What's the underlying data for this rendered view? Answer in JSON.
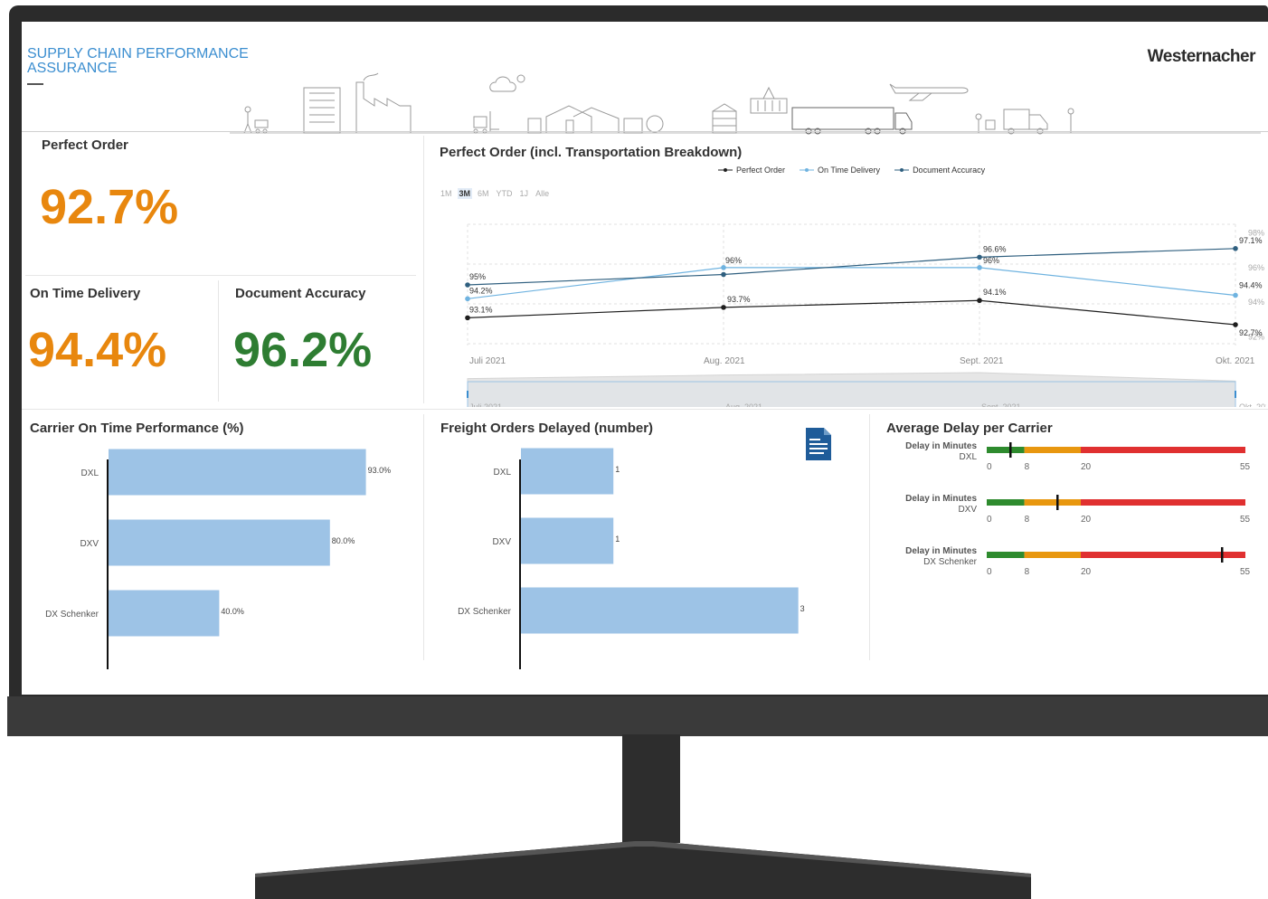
{
  "header": {
    "title_line1": "SUPPLY CHAIN PERFORMANCE",
    "title_line2": "ASSURANCE",
    "brand": "Westernacher"
  },
  "colors": {
    "orange": "#e8870e",
    "green": "#2e7d32",
    "bar_blue": "#9dc3e6",
    "accent_blue": "#3b8ed0",
    "dark_line": "#1e1e1e",
    "bullet_green": "#2e8b2e",
    "bullet_orange": "#e8970f",
    "bullet_red": "#e03030"
  },
  "kpis": {
    "perfect_order": {
      "label": "Perfect Order",
      "value": "92.7%"
    },
    "on_time": {
      "label": "On Time Delivery",
      "value": "94.4%"
    },
    "doc_accuracy": {
      "label": "Document Accuracy",
      "value": "96.2%"
    }
  },
  "line_panel": {
    "title": "Perfect Order (incl. Transportation Breakdown)",
    "legend": [
      "Perfect Order",
      "On Time Delivery",
      "Document Accuracy"
    ],
    "range_buttons": [
      "1M",
      "3M",
      "6M",
      "YTD",
      "1J",
      "Alle"
    ],
    "active_range": "3M",
    "right_ticks": [
      "98%",
      "96%",
      "94%",
      "92%"
    ],
    "navigator_labels": [
      "Juli 2021",
      "Aug. 2021",
      "Sept. 2021",
      "Okt. 2021"
    ]
  },
  "chart_data": [
    {
      "type": "line",
      "title": "Perfect Order (incl. Transportation Breakdown)",
      "categories": [
        "Juli 2021",
        "Aug. 2021",
        "Sept. 2021",
        "Okt. 2021"
      ],
      "ylim": [
        91.5,
        98.5
      ],
      "legend_position": "top-right",
      "series": [
        {
          "name": "Perfect Order",
          "values": [
            93.1,
            93.7,
            94.1,
            92.7
          ],
          "labels": [
            "93.1%",
            "93.7%",
            "94.1%",
            "92.7%"
          ],
          "color": "#1e1e1e"
        },
        {
          "name": "On Time Delivery",
          "values": [
            94.2,
            96,
            96,
            94.4
          ],
          "labels": [
            "94.2%",
            "96%",
            "96%",
            "94.4%"
          ],
          "color": "#6fb3e0"
        },
        {
          "name": "Document Accuracy",
          "values": [
            95,
            95.6,
            96.6,
            97.1
          ],
          "labels": [
            "95%",
            "",
            "96.6%",
            "97.1%"
          ],
          "color": "#2f5f7f"
        }
      ]
    },
    {
      "type": "bar",
      "title": "Carrier On Time Performance (%)",
      "categories": [
        "DXL",
        "DXV",
        "DX Schenker"
      ],
      "values": [
        93.0,
        80.0,
        40.0
      ],
      "labels": [
        "93.0%",
        "80.0%",
        "40.0%"
      ],
      "xlim": [
        0,
        100
      ]
    },
    {
      "type": "bar",
      "title": "Freight Orders Delayed (number)",
      "categories": [
        "DXL",
        "DXV",
        "DX Schenker"
      ],
      "values": [
        1,
        1,
        3
      ],
      "labels": [
        "1",
        "1",
        "3"
      ],
      "xlim": [
        0,
        3.6
      ]
    }
  ],
  "bullet_panel": {
    "title": "Average Delay per Carrier",
    "scale_ticks": [
      "0",
      "8",
      "20",
      "55"
    ],
    "scale": {
      "max": 55,
      "green_to": 8,
      "orange_to": 20
    },
    "items": [
      {
        "label": "Delay in Minutes",
        "carrier": "DXL",
        "value": 5
      },
      {
        "label": "Delay in Minutes",
        "carrier": "DXV",
        "value": 15
      },
      {
        "label": "Delay in Minutes",
        "carrier": "DX Schenker",
        "value": 50
      }
    ]
  }
}
